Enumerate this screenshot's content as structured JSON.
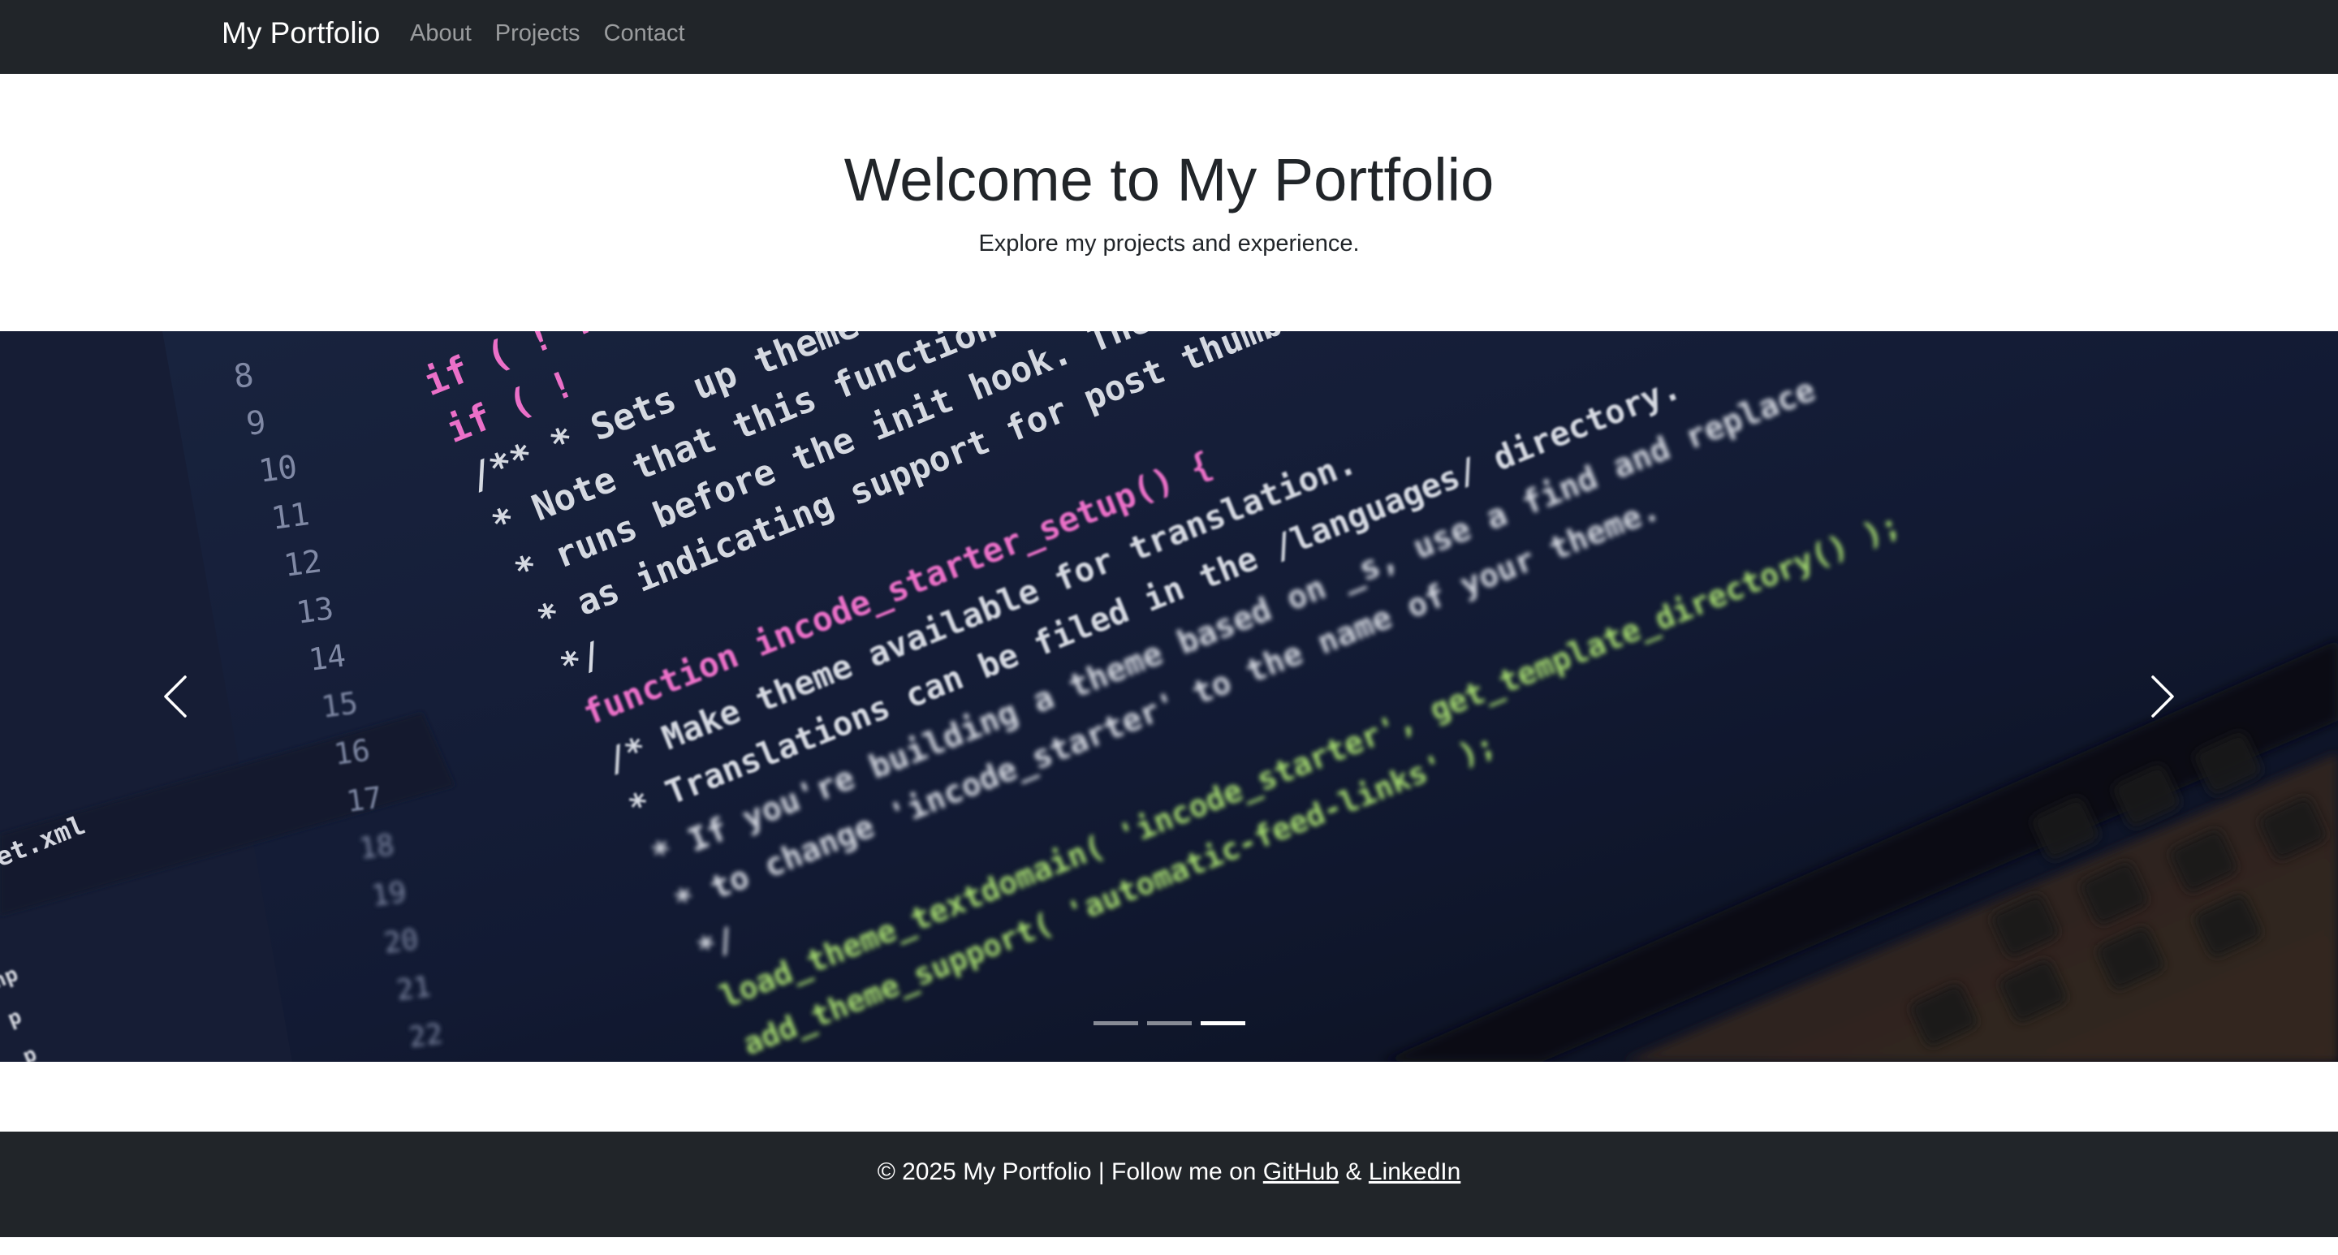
{
  "navbar": {
    "brand": "My Portfolio",
    "links": [
      "About",
      "Projects",
      "Contact"
    ]
  },
  "hero": {
    "title": "Welcome to My Portfolio",
    "subtitle": "Explore my projects and experience."
  },
  "carousel": {
    "slide_count": 3,
    "active_index": 2,
    "image_code_lines": [
      {
        "num": "8",
        "text": "if ( ! fun"
      },
      {
        "num": "9",
        "text": "if ( !"
      },
      {
        "num": "10",
        "text": "/**  * Sets up theme defa"
      },
      {
        "num": "11",
        "text": " * Note that this function is ho"
      },
      {
        "num": "12",
        "text": " * runs before the init hook. The ini"
      },
      {
        "num": "13",
        "text": " * as indicating support for post thumbnails"
      },
      {
        "num": "14",
        "text": " */"
      },
      {
        "num": "15",
        "text": "function incode_starter_setup() {"
      },
      {
        "num": "16",
        "text": " /* Make theme available for translation."
      },
      {
        "num": "17",
        "text": "  * Translations can be filed in the /languages/ directory."
      },
      {
        "num": "18",
        "text": "  * If you're building a theme based on _s, use a find and replace"
      },
      {
        "num": "19",
        "text": "  * to change 'incode_starter' to the name of your theme."
      },
      {
        "num": "20",
        "text": "  */"
      },
      {
        "num": "21",
        "text": " load_theme_textdomain( 'incode_starter', get_template_directory() );"
      },
      {
        "num": "22",
        "text": " add_theme_support( 'automatic-feed-links' );"
      }
    ],
    "image_sidebar_text": "et.xml",
    "image_sidebar_items": [
      "hp",
      "p",
      "p",
      "ion"
    ],
    "colors": {
      "keyword": "#ff7ad9",
      "function_name": "#5cc8ff",
      "string": "#b6f07a",
      "comment": "#e8ecf5",
      "line_number": "#8b95b3"
    }
  },
  "footer": {
    "prefix": "© 2025 My Portfolio | Follow me on",
    "github": "GitHub",
    "amp": "&",
    "linkedin": "LinkedIn"
  }
}
